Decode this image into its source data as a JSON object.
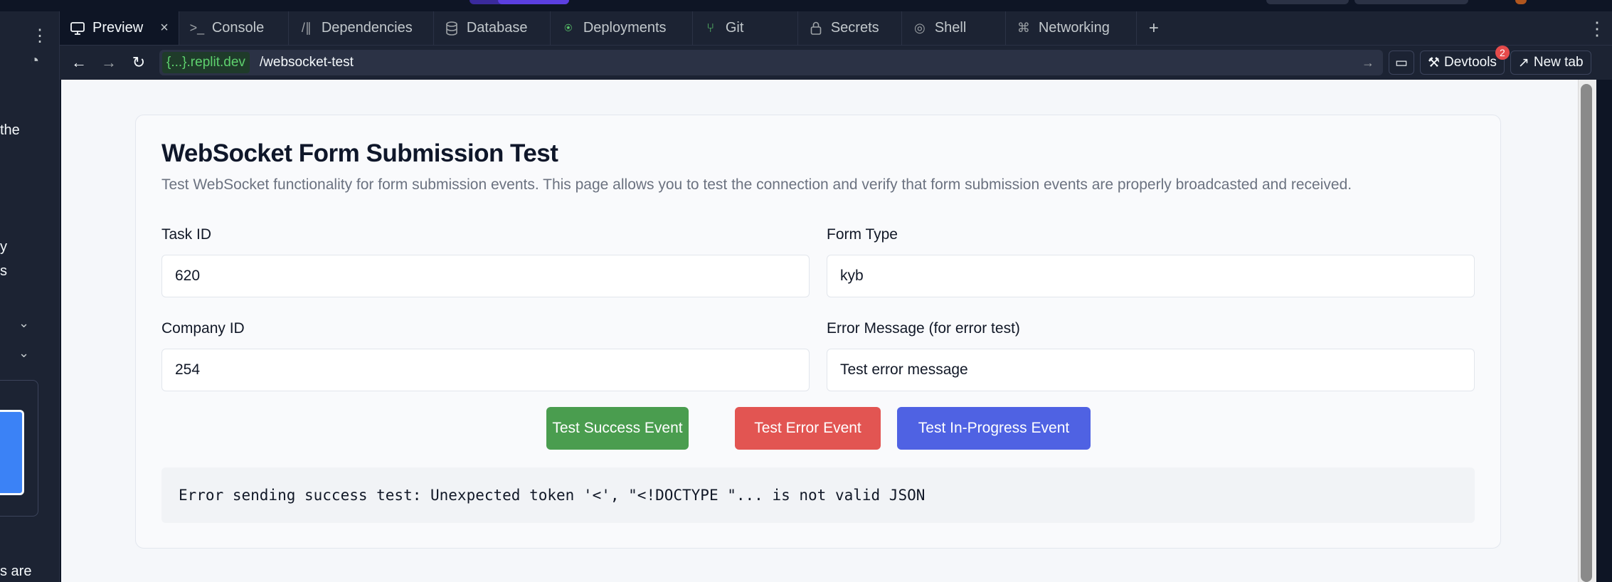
{
  "colors": {
    "ide_bg": "#0e1525",
    "panel_bg": "#1c2333",
    "success": "#4a9d4f",
    "error": "#e25552",
    "progress": "#4f62e3",
    "host_green": "#5ed16e"
  },
  "left_panel": {
    "text_fragments": [
      "the",
      "y",
      "s",
      "s are"
    ]
  },
  "tabs": [
    {
      "label": "Preview",
      "icon": "monitor-icon",
      "active": true,
      "closable": true
    },
    {
      "label": "Console",
      "icon": "terminal-prompt-icon"
    },
    {
      "label": "Dependencies",
      "icon": "dependencies-icon"
    },
    {
      "label": "Database",
      "icon": "database-icon"
    },
    {
      "label": "Deployments",
      "icon": "deployments-icon"
    },
    {
      "label": "Git",
      "icon": "git-branch-icon"
    },
    {
      "label": "Secrets",
      "icon": "lock-icon"
    },
    {
      "label": "Shell",
      "icon": "shell-icon"
    },
    {
      "label": "Networking",
      "icon": "networking-icon"
    }
  ],
  "address_bar": {
    "host_prefix": "{...}",
    "host_suffix": ".replit.dev",
    "path": "/websocket-test",
    "devtools_label": "Devtools",
    "devtools_badge": "2",
    "newtab_label": "New tab"
  },
  "page": {
    "title": "WebSocket Form Submission Test",
    "description": "Test WebSocket functionality for form submission events. This page allows you to test the connection and verify that form submission events are properly broadcasted and received.",
    "fields": {
      "task_id": {
        "label": "Task ID",
        "value": "620"
      },
      "form_type": {
        "label": "Form Type",
        "value": "kyb"
      },
      "company_id": {
        "label": "Company ID",
        "value": "254"
      },
      "error_message": {
        "label": "Error Message (for error test)",
        "value": "Test error message"
      }
    },
    "buttons": {
      "success": "Test Success Event",
      "error": "Test Error Event",
      "progress": "Test In-Progress Event"
    },
    "result": "Error sending success test: Unexpected token '<', \"<!DOCTYPE \"... is not valid JSON"
  }
}
